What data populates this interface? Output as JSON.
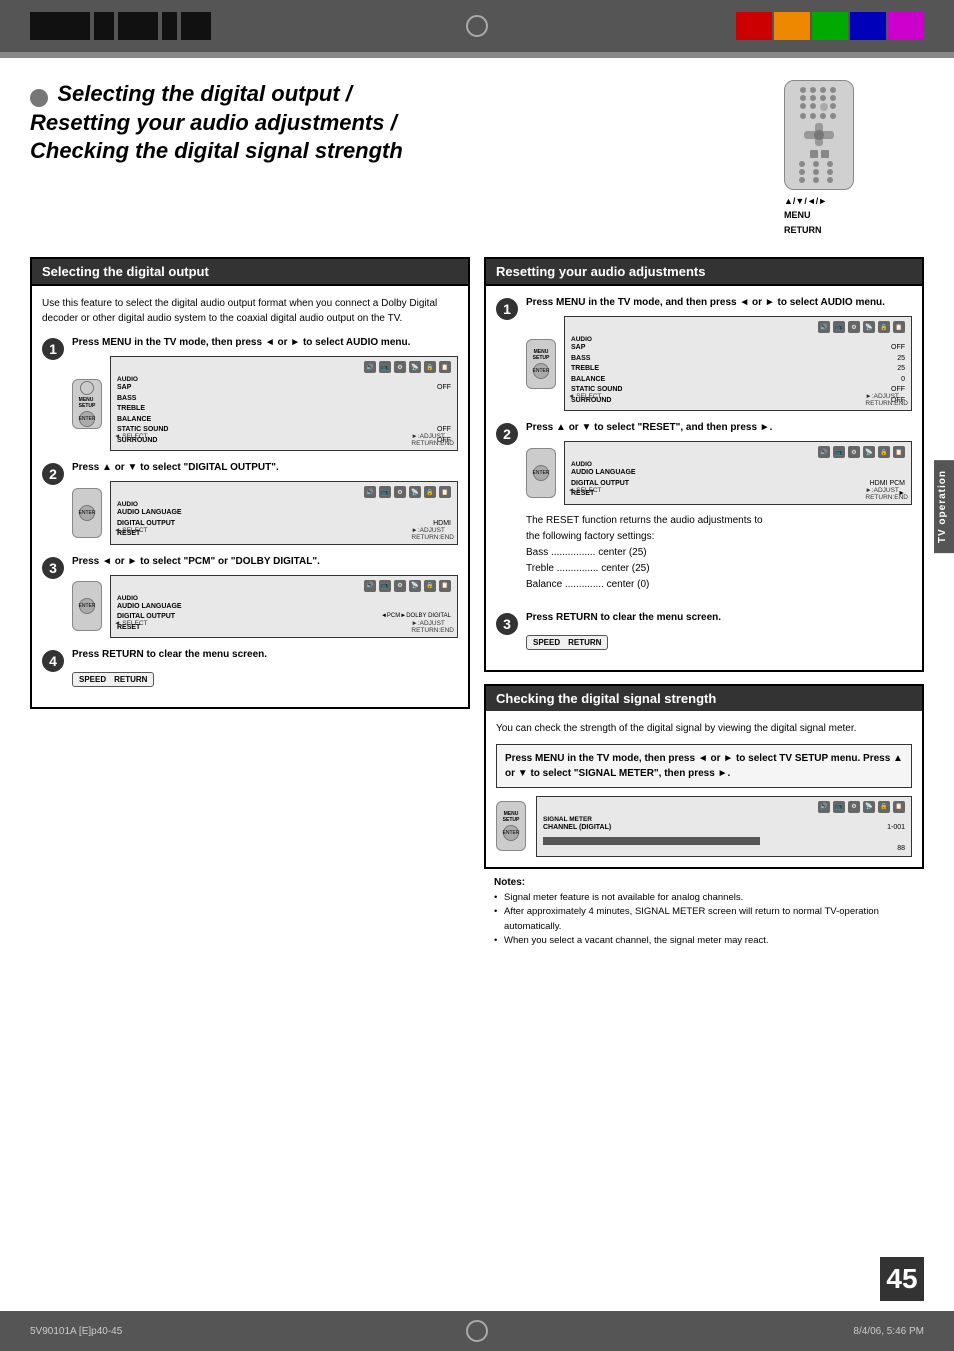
{
  "header": {
    "page_number": "45",
    "side_tab": "TV operation"
  },
  "title": {
    "line1": "Selecting the digital output /",
    "line2": "Resetting your audio adjustments /",
    "line3": "Checking the digital signal strength"
  },
  "remote_labels": {
    "arrows": "▲/▼/◄/►",
    "menu": "MENU",
    "return": "RETURN"
  },
  "left_section": {
    "heading": "Selecting the digital output",
    "intro": "Use this feature to select the digital audio output format when you connect a Dolby Digital decoder or other digital audio system to the coaxial digital audio output on the TV.",
    "steps": [
      {
        "number": "1",
        "instruction": "Press MENU in the TV mode, then press ◄ or ► to select AUDIO  menu."
      },
      {
        "number": "2",
        "instruction": "Press ▲ or ▼ to select \"DIGITAL OUTPUT\"."
      },
      {
        "number": "3",
        "instruction": "Press ◄ or ► to select \"PCM\" or \"DOLBY DIGITAL\"."
      },
      {
        "number": "4",
        "instruction": "Press RETURN to clear the menu screen."
      }
    ]
  },
  "right_reset_section": {
    "heading": "Resetting your audio adjustments",
    "steps": [
      {
        "number": "1",
        "instruction": "Press MENU in the TV mode, and then press ◄ or ► to select AUDIO  menu."
      },
      {
        "number": "2",
        "instruction": "Press ▲ or ▼ to select \"RESET\", and then press ►."
      },
      {
        "number": "3",
        "instruction": "Press RETURN to clear the menu screen."
      }
    ],
    "reset_explanation": {
      "line1": "The RESET function returns the audio adjustments to",
      "line2": "the following factory settings:",
      "bass": "Bass ................ center (25)",
      "treble": "Treble ............... center (25)",
      "balance": "Balance .............. center (0)"
    }
  },
  "right_signal_section": {
    "heading": "Checking the digital signal strength",
    "intro": "You can check the strength of the digital signal by viewing the digital signal meter.",
    "instruction": "Press MENU in the TV mode, then press ◄ or ► to select TV SETUP  menu. Press ▲ or ▼ to select \"SIGNAL METER\", then press ►.",
    "screen_data": {
      "label": "SIGNAL METER",
      "channel_digital": "CHANNEL (DIGITAL)",
      "channel_value": "1-001",
      "bar_value": "88"
    }
  },
  "notes": {
    "title": "Notes:",
    "items": [
      "Signal meter feature is not available for analog channels.",
      "After approximately 4 minutes, SIGNAL METER screen will return to normal TV-operation automatically.",
      "When you select a vacant channel, the signal meter may react."
    ]
  },
  "footer": {
    "left": "5V90101A [E]p40-45",
    "center_page": "45",
    "right": "8/4/06, 5:46 PM"
  },
  "screen_menus": {
    "audio_menu_1": {
      "title": "AUDIO",
      "items": [
        {
          "label": "SAP",
          "value": "OFF"
        },
        {
          "label": "BASS",
          "value": ""
        },
        {
          "label": "TREBLE",
          "value": ""
        },
        {
          "label": "BALANCE",
          "value": ""
        },
        {
          "label": "STATIC SOUND",
          "value": "OFF"
        },
        {
          "label": "SURROUND",
          "value": "OFF"
        }
      ]
    },
    "audio_menu_2": {
      "title": "AUDIO",
      "items": [
        {
          "label": "AUDIO LANGUAGE",
          "value": ""
        },
        {
          "label": "DIGITAL OUTPUT",
          "value": "HDMI"
        },
        {
          "label": "RESET",
          "value": ""
        }
      ]
    },
    "audio_menu_3": {
      "title": "AUDIO",
      "items": [
        {
          "label": "AUDIO LANGUAGE",
          "value": ""
        },
        {
          "label": "DIGITAL OUTPUT",
          "value": "PCM ◄►DOLBY DIGITAL"
        },
        {
          "label": "RESET",
          "value": ""
        }
      ]
    },
    "audio_reset_1": {
      "title": "AUDIO",
      "items": [
        {
          "label": "SAP",
          "value": "OFF"
        },
        {
          "label": "BASS",
          "value": "25"
        },
        {
          "label": "TREBLE",
          "value": "25"
        },
        {
          "label": "BALANCE",
          "value": "0"
        },
        {
          "label": "STATIC SOUND",
          "value": "OFF"
        },
        {
          "label": "SURROUND",
          "value": "OFF"
        }
      ]
    },
    "audio_reset_2": {
      "title": "AUDIO",
      "items": [
        {
          "label": "AUDIO LANGUAGE",
          "value": ""
        },
        {
          "label": "DIGITAL OUTPUT",
          "value": "HDMI PCM"
        },
        {
          "label": "RESET",
          "value": "►"
        }
      ]
    }
  }
}
